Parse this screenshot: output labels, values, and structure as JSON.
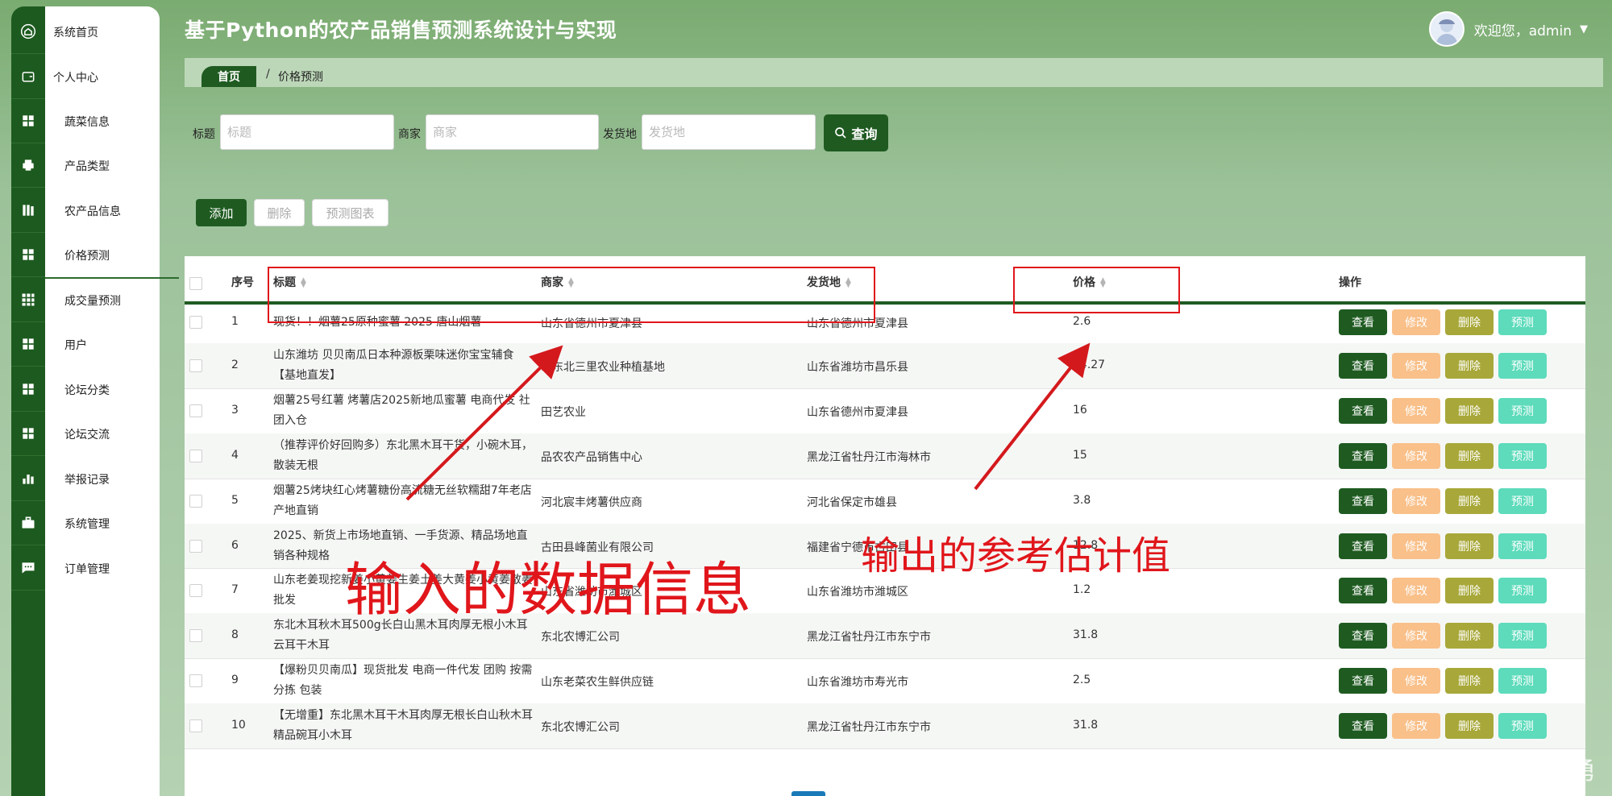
{
  "header": {
    "title": "基于Python的农产品销售预测系统设计与实现",
    "welcome": "欢迎您，admin"
  },
  "sidebar": {
    "items": [
      {
        "label": "系统首页",
        "icon": "home-icon"
      },
      {
        "label": "个人中心",
        "icon": "wallet-icon"
      },
      {
        "label": "蔬菜信息",
        "icon": "grid-icon"
      },
      {
        "label": "产品类型",
        "icon": "printer-icon"
      },
      {
        "label": "农产品信息",
        "icon": "library-icon"
      },
      {
        "label": "价格预测",
        "icon": "apps-icon"
      },
      {
        "label": "成交量预测",
        "icon": "nine-grid-icon"
      },
      {
        "label": "用户",
        "icon": "grid-icon"
      },
      {
        "label": "论坛分类",
        "icon": "grid-icon"
      },
      {
        "label": "论坛交流",
        "icon": "grid-icon"
      },
      {
        "label": "举报记录",
        "icon": "bar-chart-icon"
      },
      {
        "label": "系统管理",
        "icon": "briefcase-icon"
      },
      {
        "label": "订单管理",
        "icon": "chat-icon"
      }
    ]
  },
  "breadcrumb": {
    "home": "首页",
    "separator": "/",
    "current": "价格预测"
  },
  "search": {
    "title_label": "标题",
    "title_placeholder": "标题",
    "merchant_label": "商家",
    "merchant_placeholder": "商家",
    "origin_label": "发货地",
    "origin_placeholder": "发货地",
    "query_button": "查询"
  },
  "actions": {
    "add": "添加",
    "delete": "删除",
    "chart": "预测图表"
  },
  "table": {
    "headers": {
      "index": "序号",
      "title": "标题",
      "merchant": "商家",
      "origin": "发货地",
      "price": "价格",
      "ops": "操作"
    },
    "row_buttons": {
      "view": "查看",
      "edit": "修改",
      "delete": "删除",
      "predict": "预测"
    },
    "rows": [
      {
        "index": "1",
        "title": "现货！！烟薯25原种蜜薯 2025 唐山烟薯",
        "merchant": "山东省德州市夏津县",
        "origin": "山东省德州市夏津县",
        "price": "2.6"
      },
      {
        "index": "2",
        "title": "山东潍坊 贝贝南瓜日本种源板栗味迷你宝宝辅食【基地直发】",
        "merchant": "山东北三里农业种植基地",
        "origin": "山东省潍坊市昌乐县",
        "price": "24.27"
      },
      {
        "index": "3",
        "title": "烟薯25号红薯 烤薯店2025新地瓜蜜薯 电商代发 社团入仓",
        "merchant": "田艺农业",
        "origin": "山东省德州市夏津县",
        "price": "16"
      },
      {
        "index": "4",
        "title": "（推荐评价好回购多）东北黑木耳干货，小碗木耳，散装无根",
        "merchant": "品农农产品销售中心",
        "origin": "黑龙江省牡丹江市海林市",
        "price": "15"
      },
      {
        "index": "5",
        "title": "烟薯25烤块红心烤薯糖份高流糖无丝软糯甜7年老店产地直销",
        "merchant": "河北宸丰烤薯供应商",
        "origin": "河北省保定市雄县",
        "price": "3.8"
      },
      {
        "index": "6",
        "title": "2025、新货上市场地直销、一手货源、精品场地直销各种规格",
        "merchant": "古田县峰菌业有限公司",
        "origin": "福建省宁德市古田县",
        "price": "12.8"
      },
      {
        "index": "7",
        "title": "山东老姜现挖新姜小黄姜生姜土姜大黄姜小黄姜散姜批发",
        "merchant": "山东省潍坊市潍城区",
        "origin": "山东省潍坊市潍城区",
        "price": "1.2"
      },
      {
        "index": "8",
        "title": "东北木耳秋木耳500g长白山黑木耳肉厚无根小木耳云耳干木耳",
        "merchant": "东北农博汇公司",
        "origin": "黑龙江省牡丹江市东宁市",
        "price": "31.8"
      },
      {
        "index": "9",
        "title": "【爆粉贝贝南瓜】现货批发 电商一件代发 团购 按需分拣 包装",
        "merchant": "山东老菜农生鲜供应链",
        "origin": "山东省潍坊市寿光市",
        "price": "2.5"
      },
      {
        "index": "10",
        "title": "【无增重】东北黑木耳干木耳肉厚无根长白山秋木耳精品碗耳小木耳",
        "merchant": "东北农博汇公司",
        "origin": "黑龙江省牡丹江市东宁市",
        "price": "31.8"
      }
    ]
  },
  "annotations": {
    "input_label": "输入的数据信息",
    "output_label": "输出的参考估计值"
  },
  "watermark": "CSDN @java李杨勇",
  "colors": {
    "primary": "#1f5b21",
    "edit": "#f9c08a",
    "delete": "#a8a83a",
    "predict": "#5ddbbb",
    "annotation": "#e0161b"
  }
}
